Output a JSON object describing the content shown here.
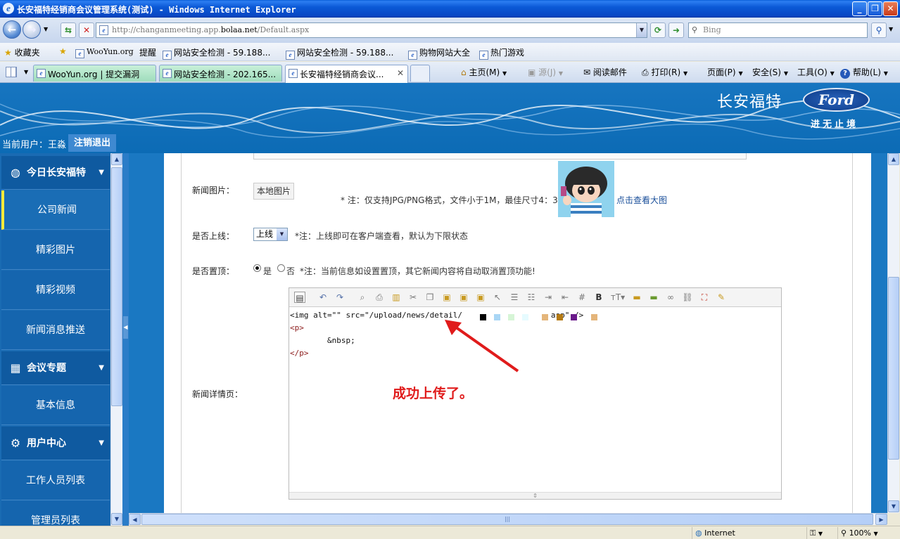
{
  "window": {
    "title": "长安福特经销商会议管理系统(测试) - Windows Internet Explorer"
  },
  "address": {
    "url_prefix": "http://changanmeeting.app.",
    "url_domain": "bolaa.net",
    "url_path": "/Default.aspx"
  },
  "search": {
    "placeholder": "Bing"
  },
  "favorites_bar": {
    "label": "收藏夹",
    "items": [
      "WooYun.org",
      "提醒",
      "网站安全检测 - 59.188...",
      "网站安全检测 - 59.188...",
      "购物网站大全",
      "热门游戏"
    ]
  },
  "tabs": [
    {
      "label": "WooYun.org | 提交漏洞"
    },
    {
      "label": "网站安全检测 - 202.165..."
    },
    {
      "label": "长安福特经销商会议..."
    }
  ],
  "command_bar": {
    "home": "主页(M)",
    "feeds": "源(J)",
    "read_mail": "阅读邮件",
    "print": "打印(R)",
    "page": "页面(P)",
    "safety": "安全(S)",
    "tools": "工具(O)",
    "help": "帮助(L)"
  },
  "header": {
    "brand": "长安福特",
    "logo_text": "Ford",
    "slogan": "进无止境",
    "current_user": "当前用户：王淼",
    "logout": "注销退出"
  },
  "sidebar": {
    "groups": [
      {
        "label": "今日长安福特",
        "icon": "globe-icon",
        "items": [
          "公司新闻",
          "精彩图片",
          "精彩视频",
          "新闻消息推送"
        ]
      },
      {
        "label": "会议专题",
        "icon": "calendar-icon",
        "items": [
          "基本信息"
        ]
      },
      {
        "label": "用户中心",
        "icon": "gear-icon",
        "items": [
          "工作人员列表",
          "管理员列表"
        ]
      }
    ],
    "selected": "公司新闻"
  },
  "form": {
    "image_label": "新闻图片：",
    "local_image_button": "本地图片",
    "image_note": "* 注：仅支持JPG/PNG格式，文件小于1M，最佳尺寸4：3",
    "view_large": "点击查看大图",
    "online_label": "是否上线：",
    "online_value": "上线",
    "online_note": "*注：上线即可在客户端查看，默认为下限状态",
    "top_label": "是否置顶：",
    "top_yes": "是",
    "top_no": "否",
    "top_note": "*注：当前信息如设置置顶，其它新闻内容将自动取消置顶功能!",
    "detail_label": "新闻详情页：",
    "code_lines": [
      "<img alt=\"\" src=\"/upload/news/detail/                   asp\" />",
      "<p>",
      "        &nbsp;",
      "</p>"
    ],
    "annotation": "成功上传了。"
  },
  "status": {
    "zone": "Internet",
    "zoom": "100%"
  },
  "colors": {
    "sidebar_bg": "#1565ae",
    "header_bg": "#1775c0",
    "annotation": "#e01b1b",
    "selected_accent": "#ffeb3b"
  }
}
